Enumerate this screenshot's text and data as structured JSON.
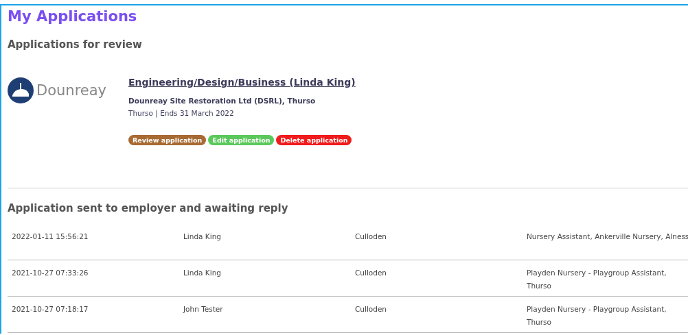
{
  "title": "My Applications",
  "review_section": {
    "heading": "Applications for review",
    "application": {
      "logo_text": "Dounreay",
      "job_title": "Engineering/Design/Business (Linda King)",
      "employer": "Dounreay Site Restoration Ltd (DSRL), Thurso",
      "details": "Thurso | Ends 31 March 2022",
      "buttons": [
        {
          "label": "Review application",
          "kind": "review"
        },
        {
          "label": "Edit application",
          "kind": "edit"
        },
        {
          "label": "Delete application",
          "kind": "delete"
        }
      ]
    }
  },
  "sent_section": {
    "heading": "Application sent to employer and awaiting reply",
    "rows": [
      {
        "date": "2022-01-11 15:56:21",
        "applicant": "Linda King",
        "location": "Culloden",
        "job": "Nursery Assistant, Ankerville Nursery, Alness"
      },
      {
        "date": "2021-10-27 07:33:26",
        "applicant": "Linda King",
        "location": "Culloden",
        "job": "Playden Nursery - Playgroup Assistant, Thurso"
      },
      {
        "date": "2021-10-27 07:18:17",
        "applicant": "John Tester",
        "location": "Culloden",
        "job": "Playden Nursery - Playgroup Assistant, Thurso"
      }
    ]
  }
}
